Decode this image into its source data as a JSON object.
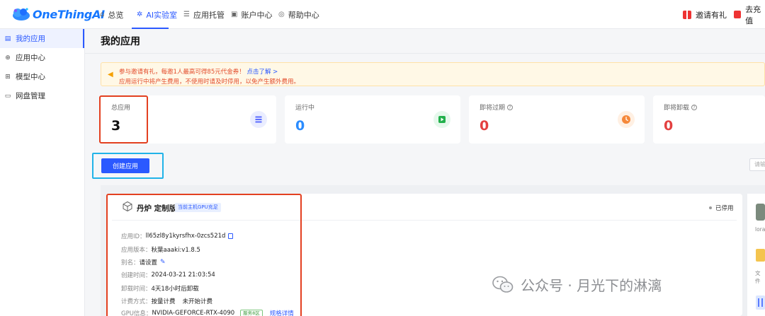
{
  "brand": {
    "name": "OneThingAI",
    "accent": "#2b59ff",
    "logo_color": "#1677ff"
  },
  "topnav": {
    "items": [
      {
        "icon": "home-icon",
        "label": "总览"
      },
      {
        "icon": "lab-icon",
        "label": "AI实验室"
      },
      {
        "icon": "server-icon",
        "label": "应用托管"
      },
      {
        "icon": "account-icon",
        "label": "账户中心"
      },
      {
        "icon": "help-icon",
        "label": "帮助中心"
      }
    ],
    "invite": "邀请有礼",
    "recharge": "去充值"
  },
  "sidebar": {
    "items": [
      {
        "icon": "app-icon",
        "label": "我的应用",
        "active": true
      },
      {
        "icon": "globe-icon",
        "label": "应用中心"
      },
      {
        "icon": "model-icon",
        "label": "模型中心"
      },
      {
        "icon": "disk-icon",
        "label": "网盘管理"
      }
    ]
  },
  "page": {
    "title": "我的应用"
  },
  "notice": {
    "line1": "参与邀请有礼，每邀1人最高可得85元代金券！",
    "link": "点击了解 >",
    "line2": "应用运行中将产生费用，不使用时请及时停用，以免产生额外费用。",
    "text_color": "#e34d2c"
  },
  "stats": [
    {
      "label": "总应用",
      "value": "3",
      "value_color": "#111111",
      "badge_color": "#eaedff",
      "icon": "list-icon",
      "icon_color": "#5b6cff"
    },
    {
      "label": "运行中",
      "value": "0",
      "value_color": "#2b8cff",
      "badge_color": "#e6f8ec",
      "icon": "play-icon",
      "icon_color": "#22b04b"
    },
    {
      "label": "即将过期",
      "value": "0",
      "value_color": "#e34040",
      "badge_color": "#fff0e3",
      "icon": "clock-icon",
      "icon_color": "#f5883a"
    },
    {
      "label": "即将卸载",
      "value": "0",
      "value_color": "#e34040"
    }
  ],
  "create_button": "创建应用",
  "search": {
    "placeholder": "请输"
  },
  "app": {
    "name": "丹炉 定制版",
    "tag": "当前主机GPU充足",
    "status": "已停用",
    "id_label": "应用ID：",
    "id_value": "ll65zl8y1kyrsfhx-0zcs521d",
    "version_label": "应用版本：",
    "version_value": "秋葉aaaki:v1.8.5",
    "alias_label": "别名：",
    "alias_value": "请设置",
    "created_label": "创建时间：",
    "created_value": "2024-03-21 21:03:54",
    "uninstall_label": "卸载时间：",
    "uninstall_value": "4天18小时后卸载",
    "billing_label": "计费方式：",
    "billing_value": "按量计费",
    "billing_state": "未开始计费",
    "gpu_label": "GPU信息：",
    "gpu_value": "NVIDIA-GEFORCE-RTX-4090",
    "gpu_region": "服务8区",
    "spec_link": "规格详情"
  },
  "side_cards": {
    "lora": "lora",
    "file": "文件"
  },
  "watermark": "公众号 · 月光下的淋漓"
}
